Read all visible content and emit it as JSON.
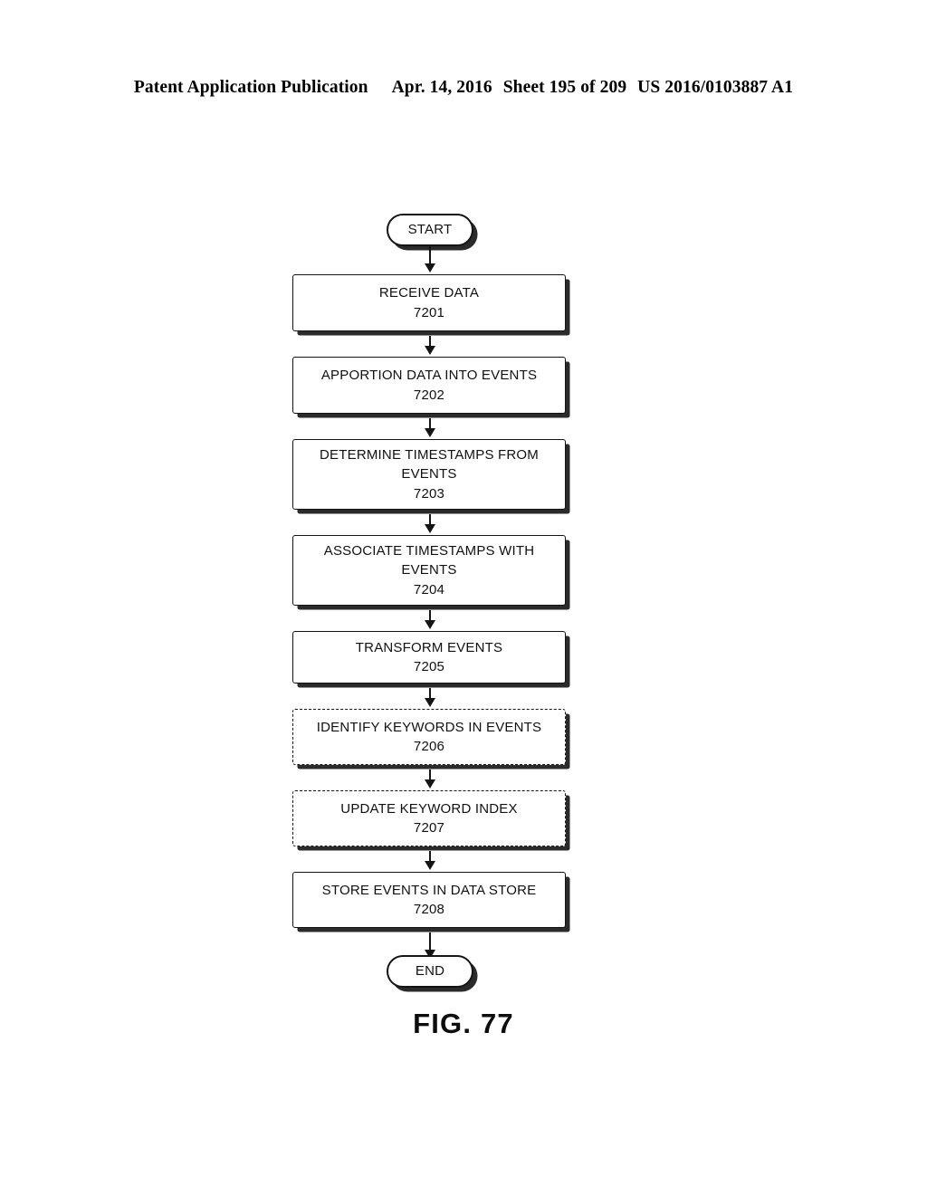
{
  "header": {
    "publication": "Patent Application Publication",
    "date": "Apr. 14, 2016",
    "sheet": "Sheet 195 of 209",
    "patent_number": "US 2016/0103887 A1"
  },
  "figure": {
    "caption": "FIG. 77",
    "start_label": "START",
    "end_label": "END",
    "steps": [
      {
        "title": "RECEIVE DATA",
        "line2": "",
        "ref": "7201",
        "style": "solid"
      },
      {
        "title": "APPORTION DATA INTO EVENTS",
        "line2": "",
        "ref": "7202",
        "style": "solid"
      },
      {
        "title": "DETERMINE TIMESTAMPS FROM",
        "line2": "EVENTS",
        "ref": "7203",
        "style": "solid"
      },
      {
        "title": "ASSOCIATE TIMESTAMPS WITH",
        "line2": "EVENTS",
        "ref": "7204",
        "style": "solid"
      },
      {
        "title": "TRANSFORM EVENTS",
        "line2": "",
        "ref": "7205",
        "style": "solid"
      },
      {
        "title": "IDENTIFY KEYWORDS IN EVENTS",
        "line2": "",
        "ref": "7206",
        "style": "dashed"
      },
      {
        "title": "UPDATE KEYWORD INDEX",
        "line2": "",
        "ref": "7207",
        "style": "dashed"
      },
      {
        "title": "STORE EVENTS IN DATA STORE",
        "line2": "",
        "ref": "7208",
        "style": "solid"
      }
    ]
  }
}
